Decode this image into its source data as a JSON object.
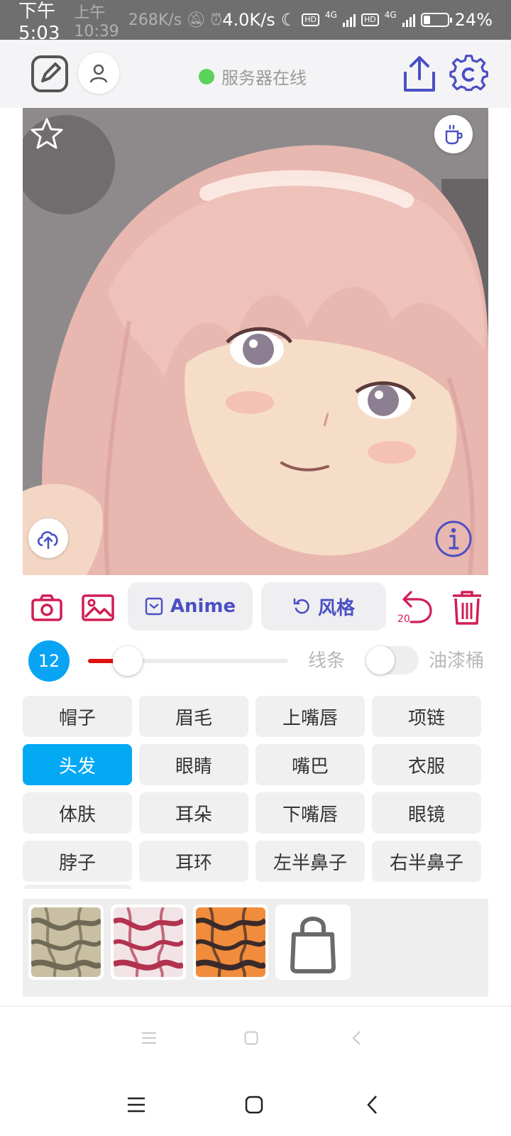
{
  "status_bar": {
    "time": "下午5:03",
    "time_ghost": "上午10:39",
    "speed_ghost": "268K/s",
    "network_speed": "4.0K/s",
    "network_1": "4G",
    "network_2": "4G",
    "hd_label": "HD",
    "battery": "24%"
  },
  "header": {
    "server_status": "服务器在线",
    "server_status_color": "#5ad35a"
  },
  "canvas": {
    "icons": [
      "star-icon",
      "coffee-cup-icon",
      "cloud-upload-icon",
      "info-icon"
    ]
  },
  "actions": {
    "anime_label": "Anime",
    "style_label": "风格",
    "undo_count": "20",
    "accent_color": "#d21d55",
    "pill_text_color": "#4b4fc4"
  },
  "brush": {
    "size": "12",
    "size_percent": 20,
    "line_label": "线条",
    "bucket_label": "油漆桶",
    "bucket_enabled": false
  },
  "parts": [
    {
      "label": "帽子",
      "selected": false
    },
    {
      "label": "眉毛",
      "selected": false
    },
    {
      "label": "上嘴唇",
      "selected": false
    },
    {
      "label": "项链",
      "selected": false
    },
    {
      "label": "头发",
      "selected": true
    },
    {
      "label": "眼睛",
      "selected": false
    },
    {
      "label": "嘴巴",
      "selected": false
    },
    {
      "label": "衣服",
      "selected": false
    },
    {
      "label": "体肤",
      "selected": false
    },
    {
      "label": "耳朵",
      "selected": false
    },
    {
      "label": "下嘴唇",
      "selected": false
    },
    {
      "label": "眼镜",
      "selected": false
    },
    {
      "label": "脖子",
      "selected": false
    },
    {
      "label": "耳环",
      "selected": false
    },
    {
      "label": "左半鼻子",
      "selected": false
    },
    {
      "label": "右半鼻子",
      "selected": false
    }
  ],
  "textures": [
    {
      "name": "texture-olive-marble",
      "colors": [
        "#c9bfa3",
        "#6f6a55"
      ]
    },
    {
      "name": "texture-crimson-marble",
      "colors": [
        "#f2e4e6",
        "#b2324f"
      ]
    },
    {
      "name": "texture-tiger-orange",
      "colors": [
        "#f08c3c",
        "#3a2a2a"
      ]
    },
    {
      "name": "texture-locked",
      "colors": [
        "#ffffff",
        "#6a6a6a"
      ]
    }
  ]
}
